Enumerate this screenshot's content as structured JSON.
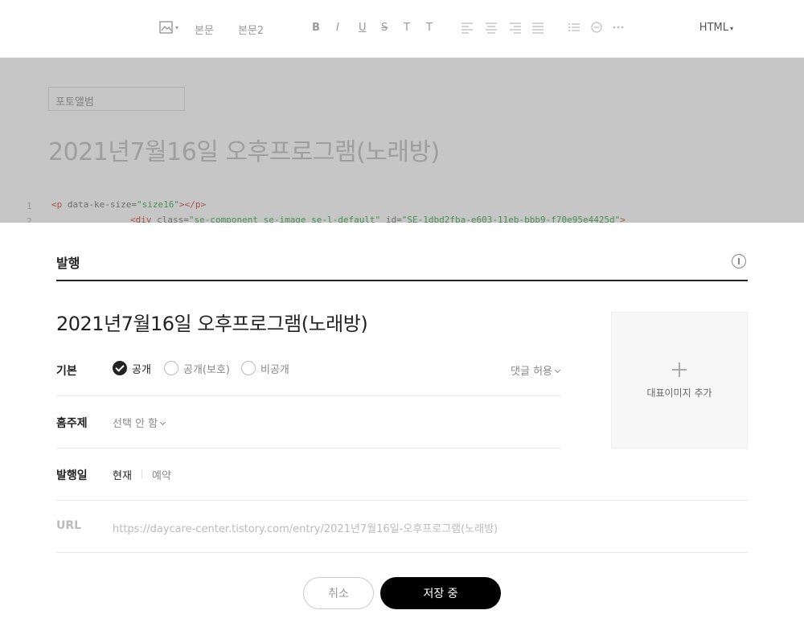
{
  "toolbar": {
    "items": [
      "본문",
      "본문2",
      "B",
      "I",
      "U",
      "S",
      "T",
      "T"
    ],
    "html_mode_label": "HTML"
  },
  "editor": {
    "category_label": "포토앨범",
    "title": "2021년7월16일 오후프로그램(노래방)",
    "code_lines": [
      {
        "num": "1",
        "tag_open": "<p",
        "attr": " data-ke-size=",
        "val": "\"size16\"",
        "tag_close": "></p>"
      },
      {
        "num": "2",
        "tag_open": "<div",
        "attr": " class=",
        "val": "\"se-component se-image se-l-default\"",
        "attr2": " id=",
        "val2": "\"SE-1dbd2fba-e603-11eb-bbb9-f70e95e4425d\"",
        "tag_close": ">"
      }
    ]
  },
  "publish": {
    "header_title": "발행",
    "post_title": "2021년7월16일 오후프로그램(노래방)",
    "visibility": {
      "label": "기본",
      "options": [
        "공개",
        "공개(보호)",
        "비공개"
      ],
      "selected": "공개",
      "comment_setting": "댓글 허용"
    },
    "home_topic": {
      "label": "홈주제",
      "value": "선택 안 함"
    },
    "publish_date": {
      "label": "발행일",
      "now": "현재",
      "reserve": "예약"
    },
    "url": {
      "label": "URL",
      "value": "https://daycare-center.tistory.com/entry/2021년7월16일-오후프로그램(노래방)"
    },
    "thumbnail": {
      "label": "대표이미지 추가"
    },
    "buttons": {
      "cancel": "취소",
      "save": "저장 중"
    }
  }
}
